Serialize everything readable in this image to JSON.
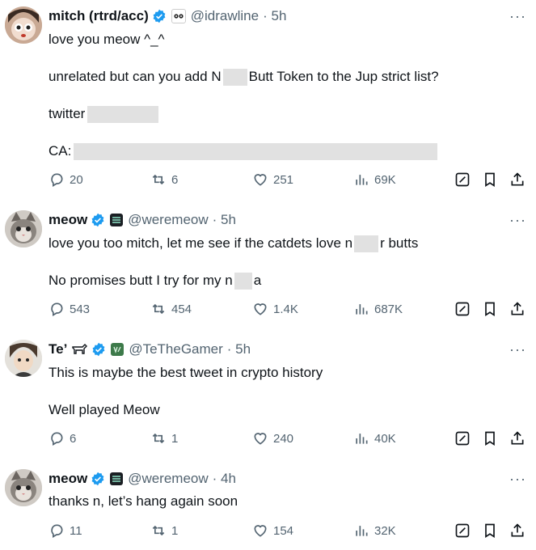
{
  "tweets": [
    {
      "name": "mitch (rtrd/acc)",
      "handle": "@idrawline",
      "time": "· 5h",
      "lines": [
        "love you meow ^_^",
        "",
        "",
        "twitter",
        "CA:"
      ],
      "line2a": "unrelated but can you add N",
      "line2b": "Butt Token to the Jup strict list?",
      "replies": "20",
      "reposts": "6",
      "likes": "251",
      "views": "69K"
    },
    {
      "name": "meow",
      "handle": "@weremeow",
      "time": "· 5h",
      "l1a": "love you too mitch, let me see if the catdets love n",
      "l1b": "r butts",
      "l2a": "No promises butt I try for my n",
      "l2b": "a",
      "replies": "543",
      "reposts": "454",
      "likes": "1.4K",
      "views": "687K"
    },
    {
      "name": "Te’",
      "handle": "@TeTheGamer",
      "time": "· 5h",
      "l1": "This is maybe the best tweet in crypto history",
      "l2": "Well played Meow",
      "replies": "6",
      "reposts": "1",
      "likes": "240",
      "views": "40K"
    },
    {
      "name": "meow",
      "handle": "@weremeow",
      "time": "· 4h",
      "l1": "thanks n, let’s hang again soon",
      "replies": "11",
      "reposts": "1",
      "likes": "154",
      "views": "32K"
    }
  ],
  "more_label": "···",
  "colors": {
    "verified": "#1d9bf0",
    "text": "#0f1419",
    "muted": "#536471",
    "redaction": "#e1e1e1"
  },
  "icons": [
    "reply-icon",
    "repost-icon",
    "like-icon",
    "views-icon",
    "grok-icon",
    "bookmark-icon",
    "share-icon"
  ]
}
